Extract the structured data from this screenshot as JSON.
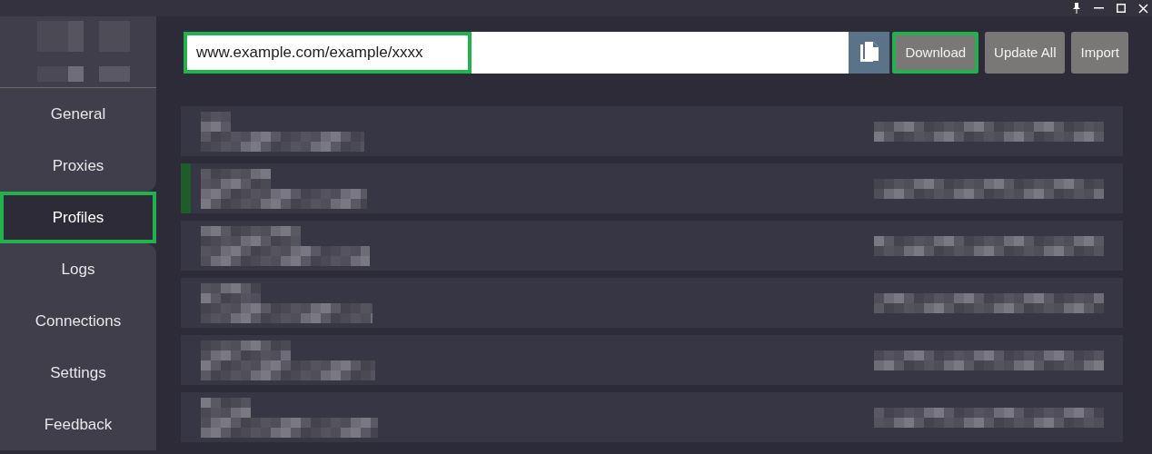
{
  "sidebar": {
    "items": [
      {
        "label": "General",
        "selected": false,
        "highlighted": false
      },
      {
        "label": "Proxies",
        "selected": false,
        "highlighted": false
      },
      {
        "label": "Profiles",
        "selected": true,
        "highlighted": true
      },
      {
        "label": "Logs",
        "selected": false,
        "highlighted": false
      },
      {
        "label": "Connections",
        "selected": false,
        "highlighted": false
      },
      {
        "label": "Settings",
        "selected": false,
        "highlighted": false
      },
      {
        "label": "Feedback",
        "selected": false,
        "highlighted": false
      }
    ]
  },
  "toolbar": {
    "url_field": {
      "value": "www.example.com/example/xxxx",
      "highlighted": true
    },
    "buttons": [
      {
        "label": "Download",
        "highlighted": true
      },
      {
        "label": "Update All",
        "highlighted": false
      },
      {
        "label": "Import",
        "highlighted": false
      }
    ]
  },
  "profiles": [
    {
      "selected": false
    },
    {
      "selected": true
    },
    {
      "selected": false
    },
    {
      "selected": false
    },
    {
      "selected": false
    },
    {
      "selected": false
    }
  ]
}
